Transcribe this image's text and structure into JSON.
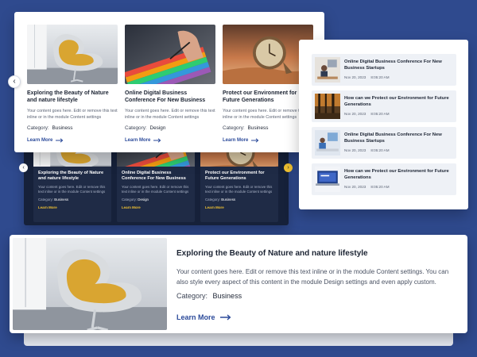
{
  "dark_carousel": {
    "cards": [
      {
        "title": "Exploring the Beauty of Nature and nature lifestyle",
        "description": "Your content goes here. Edit or remove this text inline or in the module Content settings",
        "category_label": "Category:",
        "category": "Business",
        "link": "Learn More"
      },
      {
        "title": "Online Digital Business Conference For New Business",
        "description": "Your content goes here. Edit or remove this text inline or in the module Content settings",
        "category_label": "Category:",
        "category": "Design",
        "link": "Learn More"
      },
      {
        "title": "Protect our Environment for Future Generations",
        "description": "Your content goes here. Edit or remove this text inline or in the module Content settings",
        "category_label": "Category:",
        "category": "Business",
        "link": "Learn More"
      }
    ],
    "prev_icon": "chevron-left-icon",
    "next_icon": "chevron-right-icon",
    "accent": "#f1c232"
  },
  "white_carousel": {
    "cards": [
      {
        "title": "Exploring the Beauty of Nature and nature lifestyle",
        "description": "Your content goes here. Edit or remove this text inline or in the module Content settings",
        "category_label": "Category:",
        "category": "Business",
        "link": "Learn More"
      },
      {
        "title": "Online Digital Business Conference For New Business",
        "description": "Your content goes here. Edit or remove this text inline or in the module Content settings",
        "category_label": "Category:",
        "category": "Design",
        "link": "Learn More"
      },
      {
        "title": "Protect our Environment for Future Generations",
        "description": "Your content goes here. Edit or remove this text inline or in the module Content settings",
        "category_label": "Category:",
        "category": "Business",
        "link": "Learn More"
      }
    ],
    "prev_icon": "chevron-left-icon",
    "accent": "#2b4a9a"
  },
  "post_list": {
    "items": [
      {
        "title": "Online Digital Business Conference For New Business Startups",
        "date": "Nov 20, 2023",
        "time": "8:05:20 AM"
      },
      {
        "title": "How can we Protect our Environment for Future Generations",
        "date": "Nov 20, 2023",
        "time": "8:05:20 AM"
      },
      {
        "title": "Online Digital Business Conference For New Business Startups",
        "date": "Nov 20, 2023",
        "time": "8:05:20 AM"
      },
      {
        "title": "How can we Protect our Environment for Future Generations",
        "date": "Nov 20, 2023",
        "time": "8:05:20 AM"
      }
    ]
  },
  "featured_post": {
    "title": "Exploring the Beauty of Nature and nature lifestyle",
    "description": "Your content goes here. Edit or remove this text inline or in the module Content settings. You can also style every aspect of this content in the module Design settings and even apply custom.",
    "category_label": "Category:",
    "category": "Business",
    "link": "Learn More",
    "link_icon": "arrow-right-icon"
  },
  "colors": {
    "background": "#2f4a8e",
    "dark_panel": "#16213a",
    "link_blue": "#2b4a9a"
  }
}
